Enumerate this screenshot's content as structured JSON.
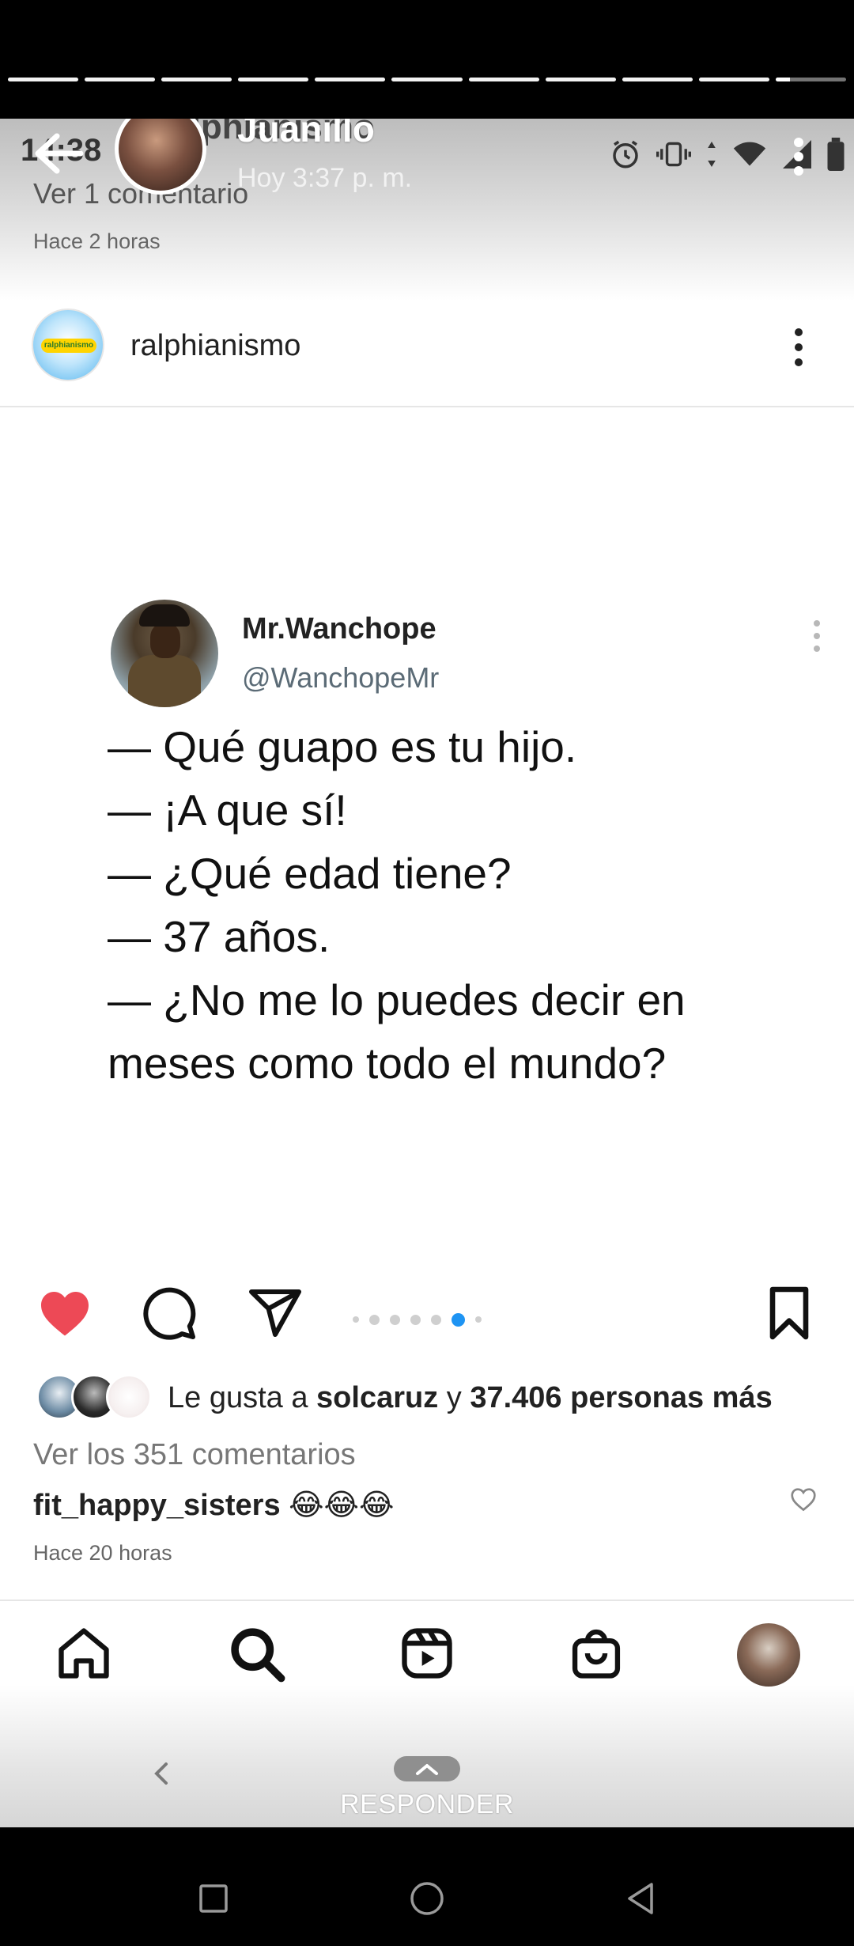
{
  "story": {
    "user_name": "Juanillo",
    "post_time": "Hoy 3:37 p. m.",
    "progress_segments": 11,
    "current_segment": 11,
    "current_progress": 0.2,
    "reply_label": "RESPONDER"
  },
  "screenshot": {
    "status_time": "14:38",
    "prev_post": {
      "ghost_title": "ralphianismo",
      "comments_link": "Ver 1 comentario",
      "timestamp": "Hace 2 horas"
    },
    "post": {
      "account_name": "ralphianismo",
      "account_badge": "ralphianismo",
      "tweet": {
        "name": "Mr.Wanchope",
        "handle": "@WanchopeMr",
        "lines": [
          "— Qué guapo es tu hijo.",
          "— ¡A que sí!",
          "— ¿Qué edad tiene?",
          "— 37 años.",
          "— ¿No me lo puedes decir en",
          "meses como todo el mundo?"
        ]
      },
      "carousel": {
        "count": 7,
        "active": 6
      },
      "likes": {
        "prefix": "Le gusta a",
        "user": "solcaruz",
        "connector": "y",
        "others": "37.406 personas más"
      },
      "comments_link": "Ver los 351 comentarios",
      "top_comment": {
        "user": "fit_happy_sisters",
        "text": "😂😂😂"
      },
      "timestamp": "Hace 20 horas"
    },
    "nav": [
      "home-icon",
      "search-icon",
      "reels-icon",
      "shop-icon",
      "profile-avatar"
    ]
  },
  "colors": {
    "like_red": "#ed4956",
    "carousel_active": "#1e94f3"
  }
}
